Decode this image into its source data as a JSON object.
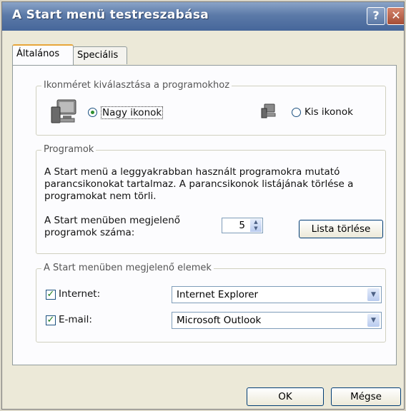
{
  "window": {
    "title": "A Start menü testreszabása",
    "help_glyph": "?",
    "close_glyph": "✕"
  },
  "tabs": [
    {
      "label": "Általános",
      "active": true
    },
    {
      "label": "Speciális",
      "active": false
    }
  ],
  "icon_size": {
    "legend": "Ikonméret kiválasztása a programokhoz",
    "large_label": "Nagy ikonok",
    "large_selected": true,
    "small_label": "Kis ikonok",
    "small_selected": false
  },
  "programs": {
    "legend": "Programok",
    "desc_line1": "A Start menü a leggyakrabban használt programokra mutató",
    "desc_line2": "parancsikonokat tartalmaz.  A parancsikonok listájának törlése a",
    "desc_line3": "programokat nem törli.",
    "count_label_line1": "A Start menüben megjelenő",
    "count_label_line2": "programok száma:",
    "count_value": "5",
    "clear_button": "Lista törlése"
  },
  "items": {
    "legend": "A Start menüben megjelenő elemek",
    "internet_label": "Internet:",
    "internet_checked": true,
    "internet_value": "Internet Explorer",
    "email_label": "E-mail:",
    "email_checked": true,
    "email_value": "Microsoft Outlook",
    "check_glyph": "✓"
  },
  "footer": {
    "ok_label": "OK",
    "cancel_label": "Mégse"
  },
  "icons": {
    "help": "help-icon",
    "close": "close-icon",
    "large": "large-monitor-icon",
    "small": "small-monitor-icon",
    "dropdown": "chevron-down-icon",
    "spin_up": "▲",
    "spin_down": "▼"
  }
}
